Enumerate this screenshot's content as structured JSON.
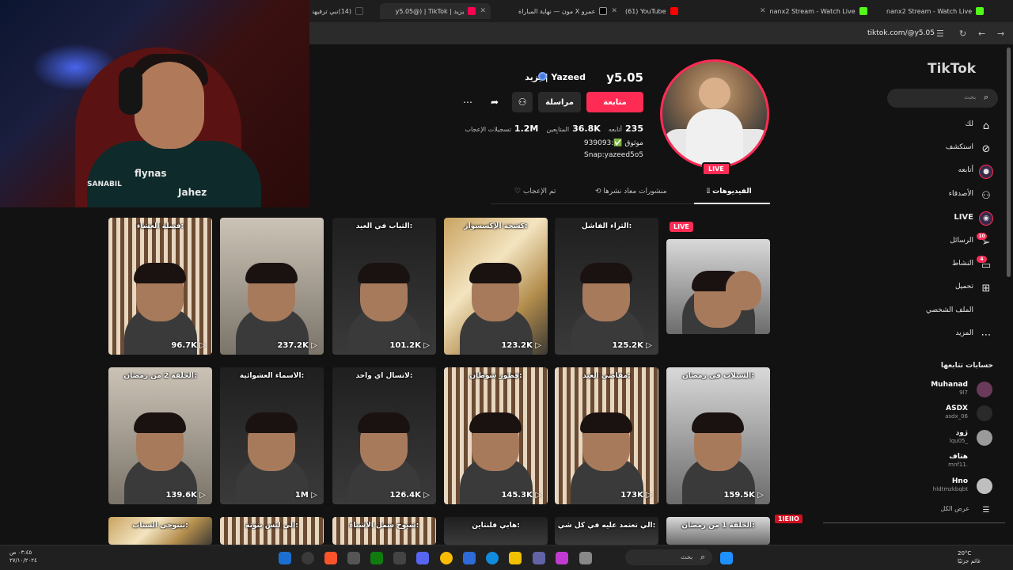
{
  "browser": {
    "tabs": [
      {
        "label": "(14)نبي ترفيهنا",
        "color": "#1e1e1e"
      },
      {
        "label": "يزيد | y5.05@) | TikTok",
        "color": "#ff0050"
      },
      {
        "label": "عمرو X مون — نهاية المباراة",
        "color": "#d02020"
      },
      {
        "label": "(61) YouTube",
        "color": "#ff0000"
      },
      {
        "label": "nanx2 Stream - Watch Live",
        "color": "#53fc18"
      },
      {
        "label": "nanx2 Stream - Watch Live",
        "color": "#53fc18"
      }
    ],
    "url": "tiktok.com/@y5.05"
  },
  "webcam": {
    "jersey_text_1": "flynas",
    "jersey_text_2": "Jahez",
    "jersey_text_3": "SANABIL"
  },
  "profile": {
    "username": "y5.05",
    "nickname": "يزيد | Yazeed",
    "live_label": "LIVE",
    "follow_label": "متابعة",
    "message_label": "مراسلة",
    "stats": [
      {
        "num": "235",
        "label": "أتابعه"
      },
      {
        "num": "36.8K",
        "label": "المتابِعين"
      },
      {
        "num": "1.2M",
        "label": "تسجيلات الإعجاب"
      }
    ],
    "bio_line1": "موثوق ✅:939093",
    "bio_line2": "Snap:yazeed5o5"
  },
  "tabs": {
    "videos": "الفيديوهات",
    "reposts": "منشورات معاد نشرها",
    "liked": "تم الإعجاب"
  },
  "videos": [
    {
      "caption": "",
      "views": "",
      "live": "LIVE"
    },
    {
      "caption": "الثراء الفاشل:",
      "views": "125.2K"
    },
    {
      "caption": "كشخة الإكسسوار:",
      "views": "123.2K"
    },
    {
      "caption": "الثياب في العيد:",
      "views": "101.2K"
    },
    {
      "caption": "",
      "views": "237.2K"
    },
    {
      "caption": "فصلة العشاء:",
      "views": "96.7K"
    },
    {
      "caption": "الشيلات في رمضان:",
      "views": "159.5K"
    },
    {
      "caption": "مقاضي العيد:",
      "views": "173K"
    },
    {
      "caption": "فطور شوطان:",
      "views": "145.3K"
    },
    {
      "caption": "لاتسأل اي واحد:",
      "views": "126.4K"
    },
    {
      "caption": "الأسماء العشوائية:",
      "views": "1M"
    },
    {
      "caption": "الحلقة 2 من رمضان:",
      "views": "139.6K"
    },
    {
      "caption": "الحلقة 1 من رمضان:",
      "views": ""
    },
    {
      "caption": "الي تعتمد عليه في كل شي:",
      "views": ""
    },
    {
      "caption": "هابي فلنتاين:",
      "views": ""
    },
    {
      "caption": "شيوخ شمل الأشياء:",
      "views": ""
    },
    {
      "caption": "الي لبس بنوتة:",
      "views": ""
    },
    {
      "caption": "يتنوجي السناب:",
      "views": ""
    }
  ],
  "sidebar": {
    "logo": "TikTok",
    "search_placeholder": "بحث",
    "items": [
      {
        "label": "لك",
        "icon": "home-icon"
      },
      {
        "label": "استكشف",
        "icon": "compass-icon"
      },
      {
        "label": "أتابعه",
        "icon": "following-icon"
      },
      {
        "label": "الأصدقاء",
        "icon": "friends-icon"
      },
      {
        "label": "LIVE",
        "icon": "live-icon"
      },
      {
        "label": "الرسائل",
        "icon": "messages-icon",
        "badge": "10"
      },
      {
        "label": "النشاط",
        "icon": "activity-icon",
        "badge": "4"
      },
      {
        "label": "تحميل",
        "icon": "upload-icon"
      },
      {
        "label": "الملف الشخصي",
        "icon": "profile-icon"
      },
      {
        "label": "المزيد",
        "icon": "more-icon"
      }
    ],
    "following_title": "حسابات تتابعها",
    "following": [
      {
        "name": "Muhanad",
        "sub": "9l7"
      },
      {
        "name": "ASDX",
        "sub": "asdx_06"
      },
      {
        "name": "ژود",
        "sub": "lqu05_"
      },
      {
        "name": "هتاف",
        "sub": "mnf11."
      },
      {
        "name": "Hno",
        "sub": "hldtmzkbqbt"
      }
    ],
    "show_all": "عرض الكل"
  },
  "overlay": {
    "tag": "1IEIIO"
  },
  "taskbar": {
    "search": "بحث",
    "time": "٠٣:٤٥ ص",
    "date": "٢٧/١٠/٢٠٢٤",
    "temp": "20°C",
    "weather": "غائم جزئيًا"
  }
}
